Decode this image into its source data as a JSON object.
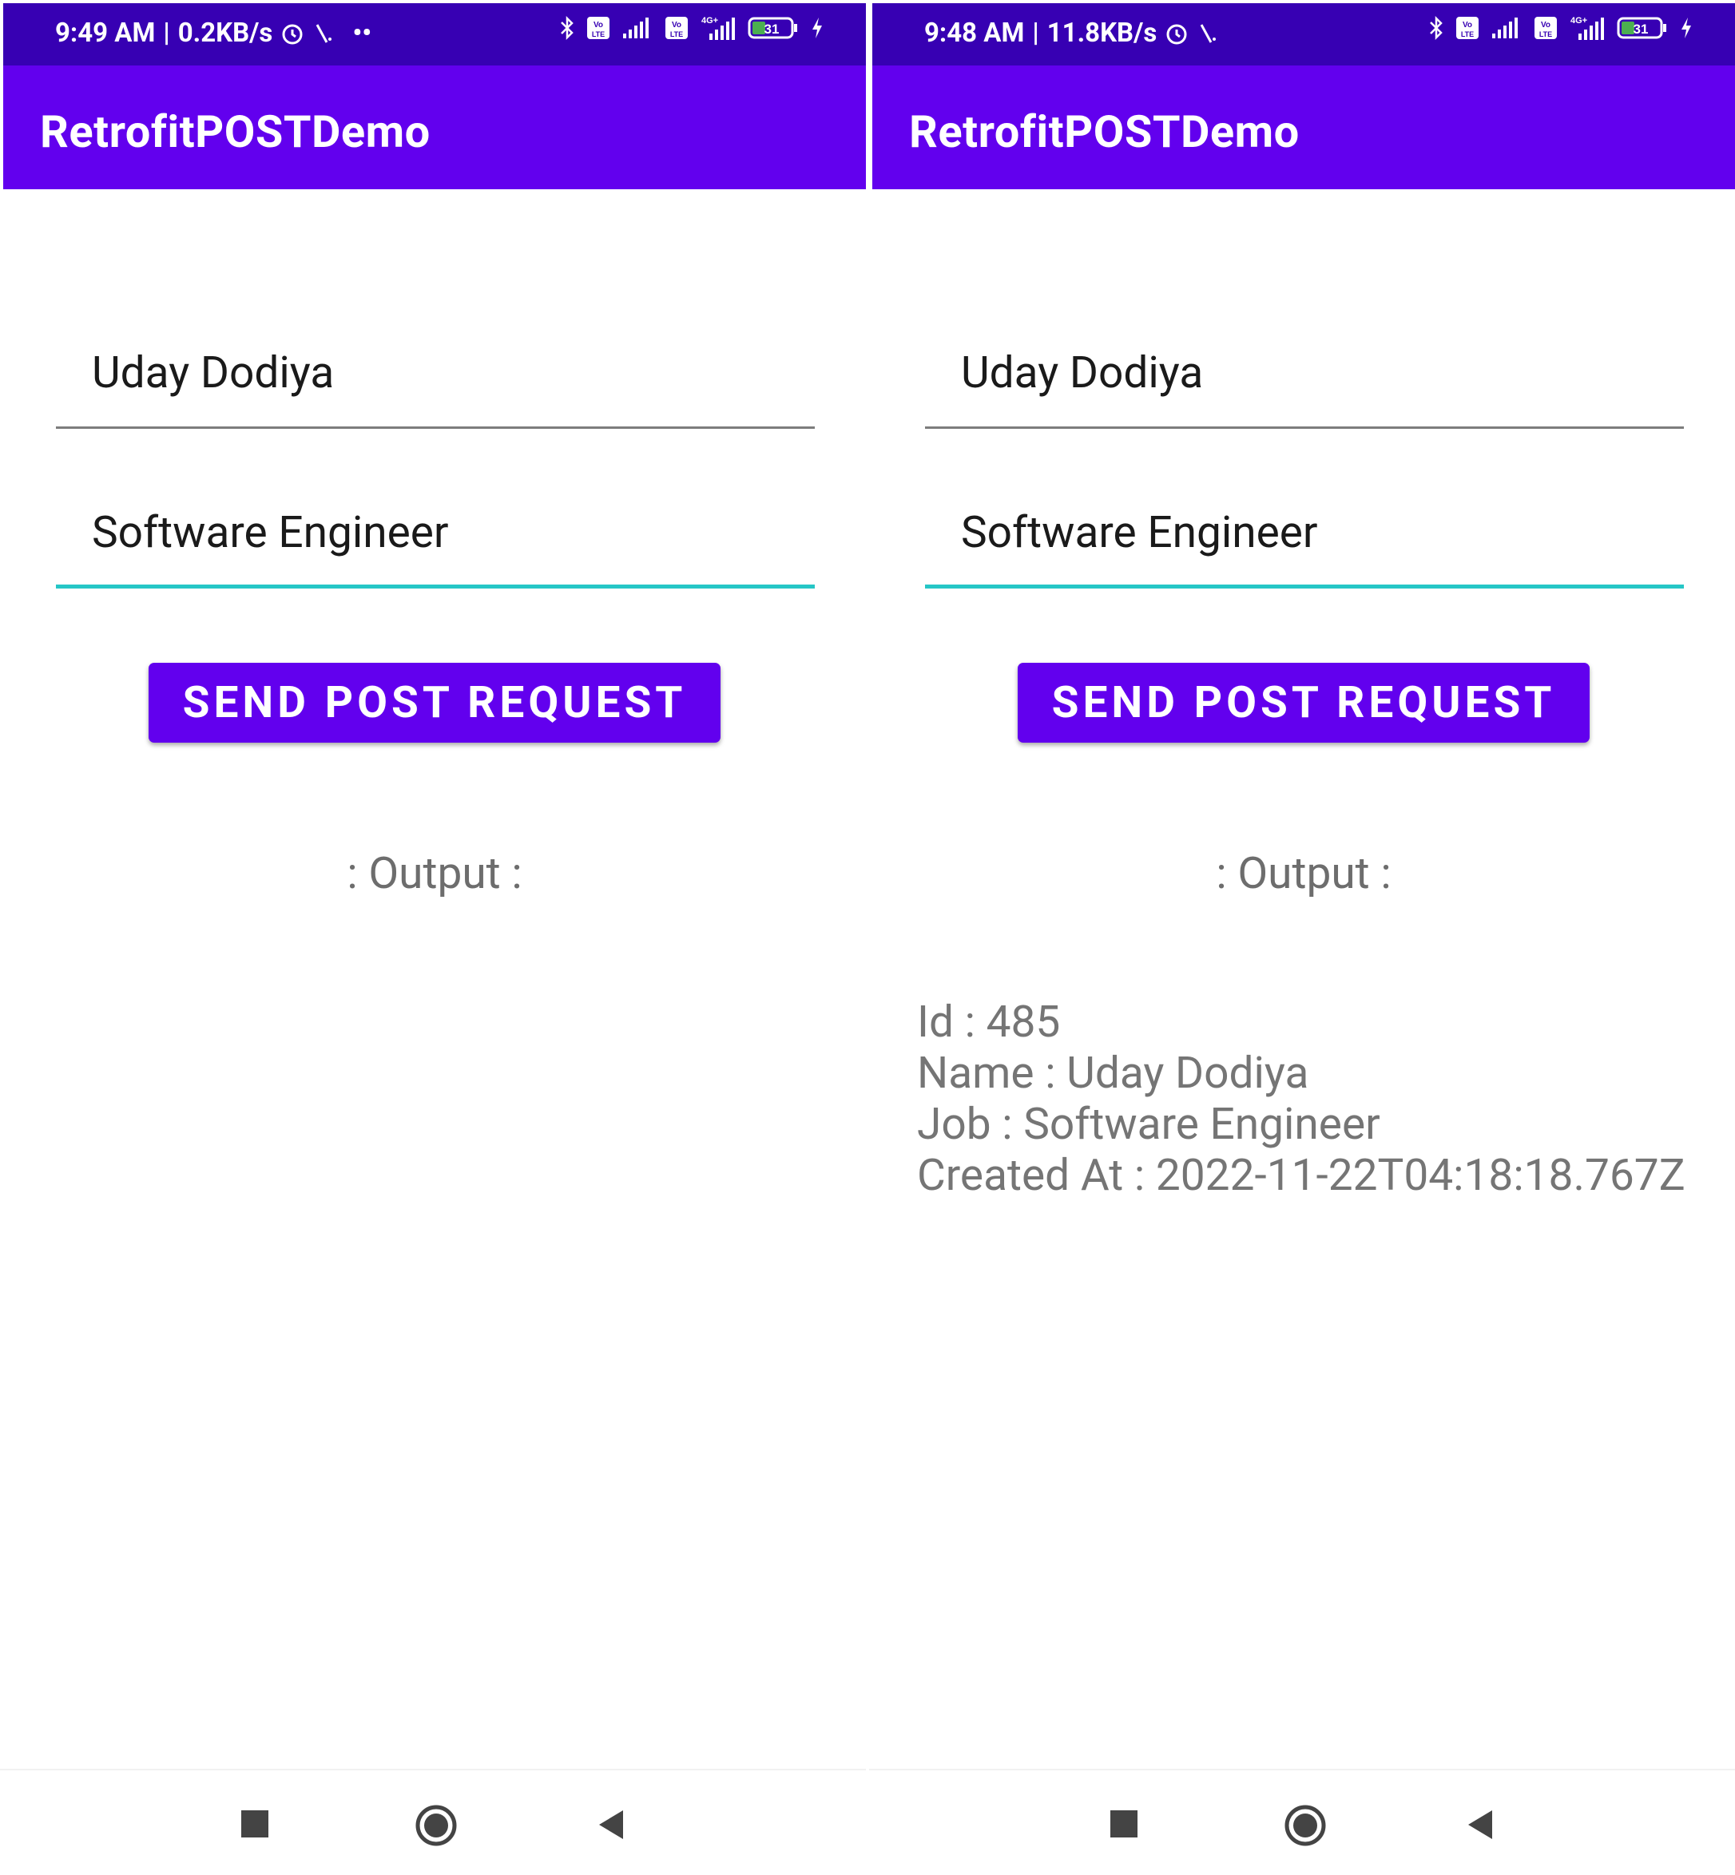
{
  "screens": [
    {
      "status": {
        "time": "9:49 AM",
        "speed": "0.2KB/s",
        "battery": "31",
        "extra_dots": "••"
      },
      "app_title": "RetrofitPOSTDemo",
      "name_value": "Uday Dodiya",
      "job_value": "Software Engineer",
      "button_label": "SEND POST REQUEST",
      "output_heading": ": Output :",
      "output_lines": []
    },
    {
      "status": {
        "time": "9:48 AM",
        "speed": "11.8KB/s",
        "battery": "31"
      },
      "app_title": "RetrofitPOSTDemo",
      "name_value": "Uday Dodiya",
      "job_value": "Software Engineer",
      "button_label": "SEND POST REQUEST",
      "output_heading": ": Output :",
      "output_lines": [
        "Id : 485",
        "Name : Uday Dodiya",
        "Job : Software Engineer",
        "Created At : 2022-11-22T04:18:18.767Z"
      ]
    }
  ],
  "colors": {
    "status_bar": "#3700b3",
    "app_bar": "#6200ee",
    "accent": "#26c6c6"
  },
  "icons": [
    "alarm-icon",
    "bluetooth-icon",
    "volte-icon",
    "signal-icon",
    "battery-icon",
    "charging-icon",
    "recents-icon",
    "home-icon",
    "back-icon"
  ]
}
